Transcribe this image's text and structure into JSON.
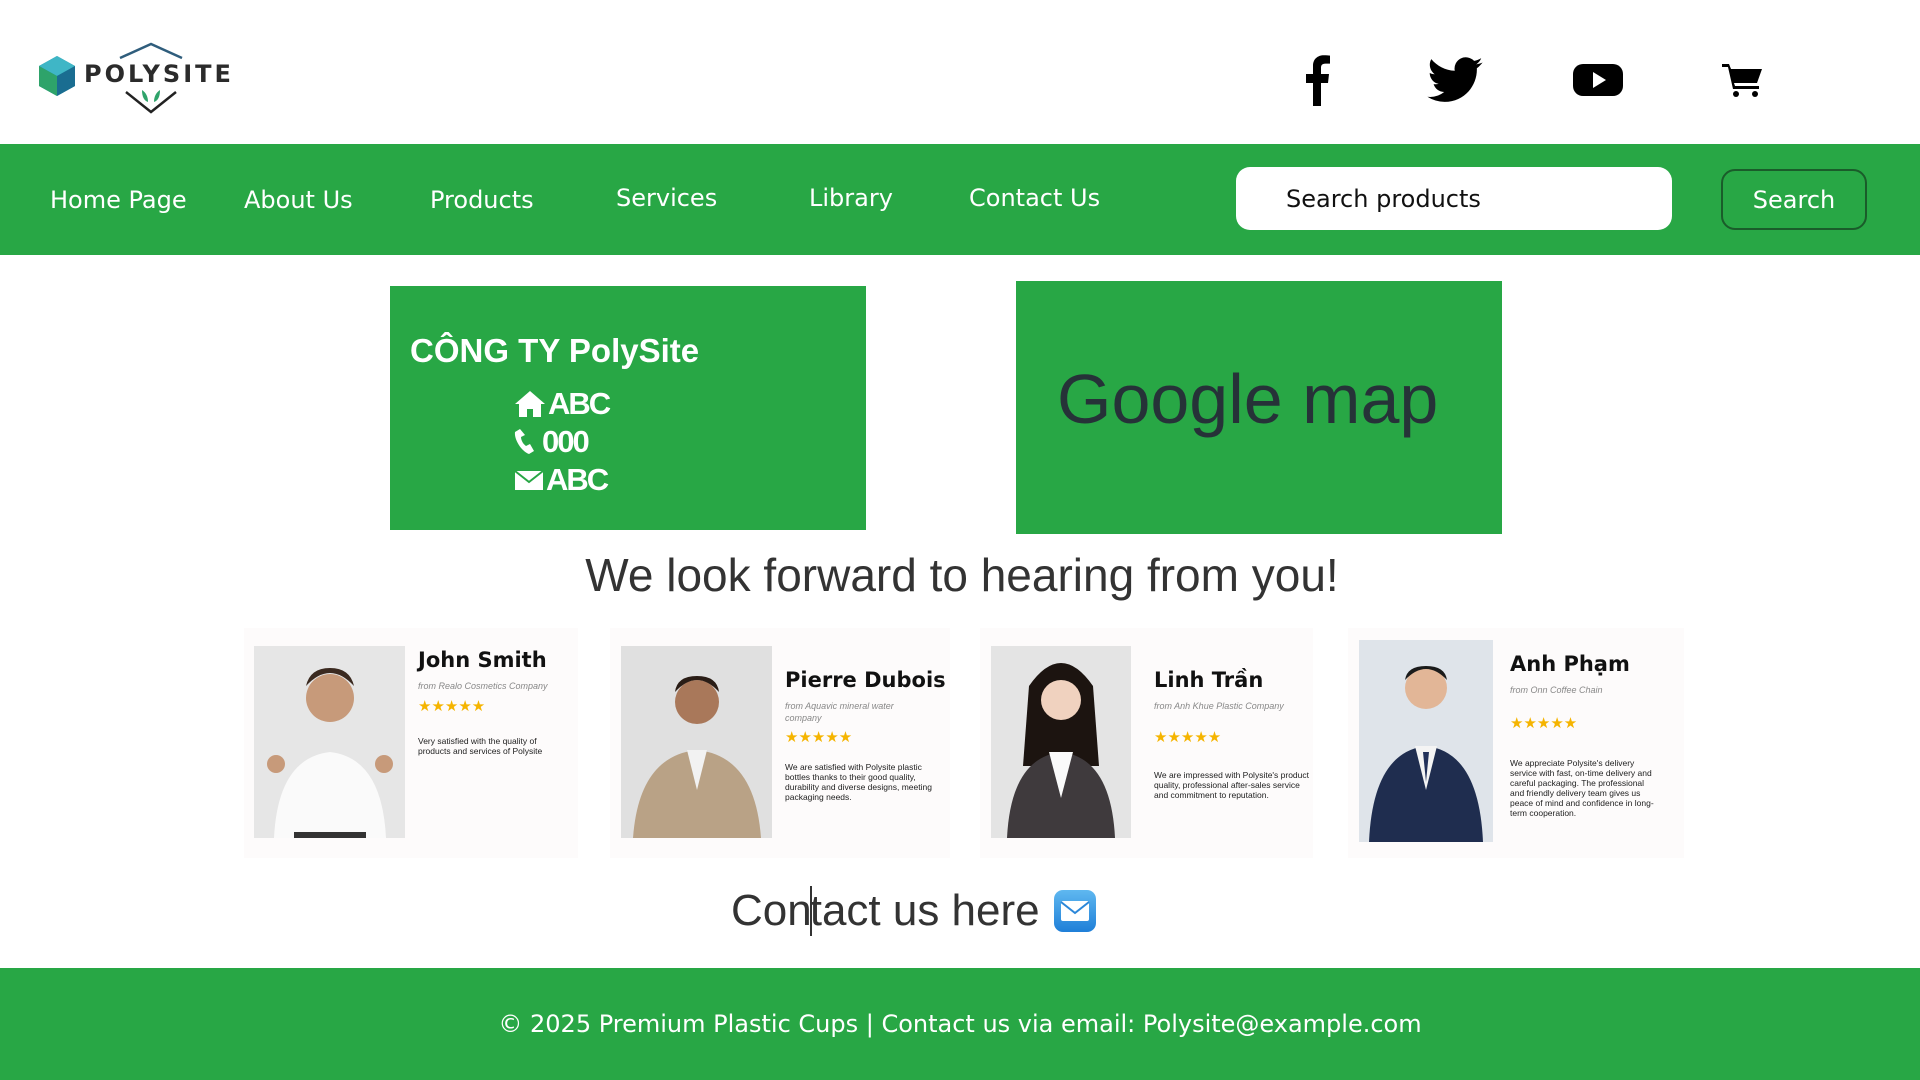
{
  "header": {
    "logo_text": "POLYSITE",
    "social_icons": [
      "facebook-icon",
      "twitter-icon",
      "youtube-icon",
      "cart-icon"
    ]
  },
  "nav": {
    "items": [
      "Home Page",
      "About Us",
      "Products",
      "Services",
      "Library",
      "Contact Us"
    ],
    "search_placeholder": "Search products",
    "search_button": "Search"
  },
  "company": {
    "title": "CÔNG TY PolySite",
    "address": "ABC",
    "phone": "000",
    "email": "ABC"
  },
  "map": {
    "label": "Google map"
  },
  "tagline": "We look forward to hearing from you!",
  "testimonials": [
    {
      "name": "John Smith",
      "from": "from Realo Cosmetics Company",
      "stars": "★★★★★",
      "quote": "Very satisfied with the quality of products and services of Polysite"
    },
    {
      "name": "Pierre Dubois",
      "from": "from Aquavic mineral water company",
      "stars": "★★★★★",
      "quote": "We are satisfied with Polysite plastic bottles thanks to their good quality, durability and diverse designs, meeting packaging needs."
    },
    {
      "name": "Linh Trần",
      "from": "from Anh Khue Plastic Company",
      "stars": "★★★★★",
      "quote": "We are impressed with Polysite's product quality, professional after-sales service and commitment to reputation."
    },
    {
      "name": "Anh Phạm",
      "from": "from Onn Coffee Chain",
      "stars": "★★★★★",
      "quote": "We appreciate Polysite's delivery service with fast, on-time delivery and careful packaging. The professional and friendly delivery team gives us peace of mind and confidence in long-term cooperation."
    }
  ],
  "contact": {
    "text_before": "Con",
    "text_after": "tact us here"
  },
  "footer": {
    "text": "© 2025 Premium Plastic Cups | Contact us via email: Polysite@example.com"
  },
  "colors": {
    "brand_green": "#28a745",
    "star": "#f5b400"
  }
}
